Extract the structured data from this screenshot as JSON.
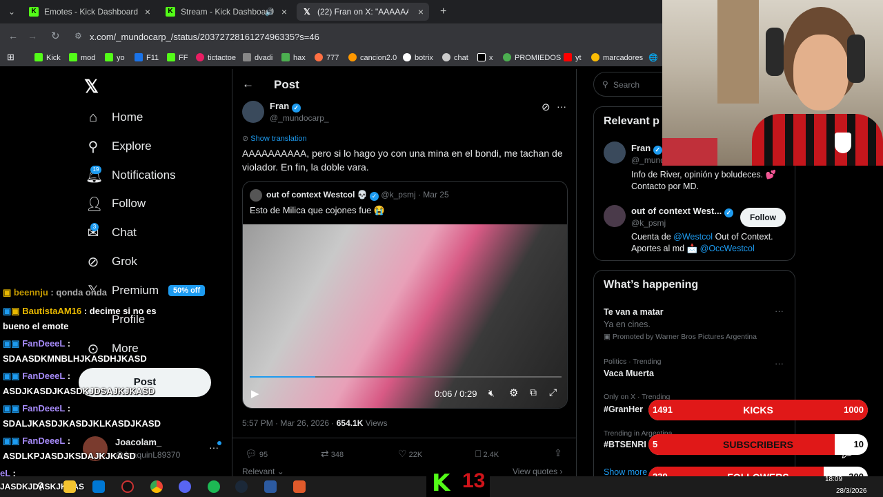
{
  "tabs": [
    {
      "title": "Emotes - Kick Dashboard",
      "favicon": "kick-icon"
    },
    {
      "title": "Stream - Kick Dashboard",
      "favicon": "kick-icon"
    },
    {
      "title": "(22) Fran on X: \"AAAAAAAAAA",
      "favicon": "x-icon"
    }
  ],
  "url": "x.com/_mundocarp_/status/2037272816127496335?s=46",
  "bookmarks": [
    "Kick",
    "mod",
    "yo",
    "F11",
    "FF",
    "tictactoe",
    "dvadi",
    "hax",
    "777",
    "cancion2.0",
    "botrix",
    "chat",
    "x",
    "PROMIEDOS",
    "yt",
    "marcadores"
  ],
  "nav": {
    "home": "Home",
    "explore": "Explore",
    "notifications": "Notifications",
    "notif_count": "19",
    "follow": "Follow",
    "chat": "Chat",
    "chat_count": "3",
    "grok": "Grok",
    "premium": "Premium",
    "premium_badge": "50% off",
    "profile": "Profile",
    "more": "More",
    "post": "Post",
    "account_name": "Joacolam_",
    "account_handle": "@JoaquinL89370"
  },
  "post": {
    "header": "Post",
    "author": "Fran",
    "handle": "@_mundocarp_",
    "show_translation": "Show translation",
    "text": "AAAAAAAAAA, pero si lo hago yo con una mina en el bondi, me tachan de violador. En fin, la doble vara.",
    "quote_author": "out of context Westcol 💀",
    "quote_handle": "@k_psmj",
    "quote_date": "· Mar 25",
    "quote_text": "Esto de Milica que cojones fue 😭",
    "video_time": "0:06 / 0:29",
    "time": "5:57 PM · Mar 26, 2026 · ",
    "views_count": "654.1K",
    "views_label": " Views",
    "replies": "95",
    "reposts": "348",
    "likes": "22K",
    "bookmarks": "2.4K",
    "relevant": "Relevant",
    "view_quotes": "View quotes"
  },
  "right": {
    "search_placeholder": "Search",
    "relevant_title": "Relevant p",
    "p1_name": "Fran",
    "p1_handle": "@_mund",
    "p1_bio": "Info de River, opinión y boludeces. 💕 Contacto por MD.",
    "p2_name": "out of context West...",
    "p2_handle": "@k_psmj",
    "p2_bio_a": "Cuenta de ",
    "p2_bio_link1": "@Westcol",
    "p2_bio_b": " Out of Context.",
    "p2_bio_c": "Aportes al md 📩 ",
    "p2_bio_link2": "@OccWestcol",
    "follow": "Follow",
    "happening_title": "What’s happening",
    "trends": [
      {
        "meta": "",
        "name": "Te van a matar",
        "sub": "Ya en cines.",
        "promo": "Promoted by Warner Bros Pictures Argentina"
      },
      {
        "meta": "Politics · Trending",
        "name": "Vaca Muerta"
      },
      {
        "meta": "Only on X · Trending",
        "name": "#GranHer"
      },
      {
        "meta": "Trending in Argentina",
        "name": "#BTSENRI"
      }
    ],
    "show_more": "Show more"
  },
  "chat": [
    {
      "name": "beennju",
      "sep": " : ",
      "msg": "qonda onda"
    },
    {
      "name": "BautistaAM16",
      "sep": " : ",
      "msg": "decime si no es"
    },
    {
      "name": "",
      "sep": "",
      "msg": "bueno el emote"
    },
    {
      "name": "FanDeeeL",
      "sep": " :",
      "msg": ""
    },
    {
      "name": "",
      "sep": "",
      "msg": "SDAASDKMNBLHJKASDHJKASD"
    },
    {
      "name": "FanDeeeL",
      "sep": " :",
      "msg": ""
    },
    {
      "name": "",
      "sep": "",
      "msg": "ASDJKASDJKASDKJDSAJKJKASD"
    },
    {
      "name": "FanDeeeL",
      "sep": " :",
      "msg": ""
    },
    {
      "name": "",
      "sep": "",
      "msg": "SDALJKASDJKASDJKLKASDJKASD"
    },
    {
      "name": "FanDeeeL",
      "sep": " :",
      "msg": ""
    },
    {
      "name": "",
      "sep": "",
      "msg": "ASDLKPJASDJKSDAJKJKASD"
    },
    {
      "name": "eL",
      "sep": " :",
      "msg": ""
    },
    {
      "name": "",
      "sep": "",
      "msg": "JASDKJDASKJKDAS"
    }
  ],
  "stats": [
    {
      "value": "1491",
      "label": "KICKS",
      "goal": "1000",
      "fill_fraction": 1.0
    },
    {
      "value": "5",
      "label": "SUBSCRIBERS",
      "goal": "10",
      "fill_fraction": 0.85
    },
    {
      "value": "239",
      "label": "FOLLOWERS",
      "goal": "300",
      "fill_fraction": 0.8
    }
  ],
  "overlay_badge": "13",
  "clock": {
    "time": "18:09",
    "date": "28/3/2026"
  },
  "colors": {
    "kick_green": "#53fc18",
    "x_blue": "#1d9bf0",
    "stat_red": "#e01818"
  }
}
